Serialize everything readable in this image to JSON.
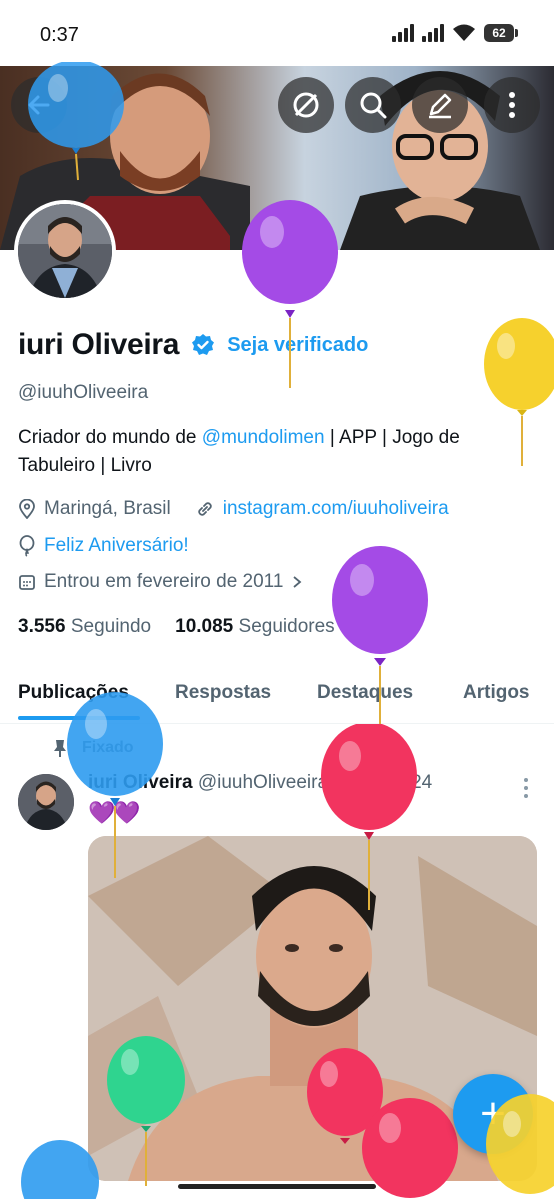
{
  "status_bar": {
    "time": "0:37",
    "battery": "62"
  },
  "profile": {
    "name": "iuri Oliveira",
    "verify_cta": "Seja verificado",
    "handle": "@iuuhOliveeira",
    "bio_prefix": "Criador do mundo de ",
    "bio_mention": "@mundolimen",
    "bio_suffix": "  | APP | Jogo de Tabuleiro | Livro",
    "location": "Maringá, Brasil",
    "website": "instagram.com/iuuholiveira",
    "birthday": "Feliz Aniversário!",
    "joined": "Entrou em fevereiro de 2011",
    "following_count": "3.556",
    "following_label": "Seguindo",
    "followers_count": "10.085",
    "followers_label": "Seguidores"
  },
  "tabs": [
    "Publicações",
    "Respostas",
    "Destaques",
    "Artigos"
  ],
  "pinned_label": "Fixado",
  "post": {
    "author": "iuri Oliveira",
    "handle": "@iuuhOliveeira",
    "date": "· 12 nov. 24",
    "text": "💜💜"
  },
  "fab_label": "+",
  "icons": [
    "back-arrow-icon",
    "no-translate-icon",
    "search-icon",
    "edit-icon",
    "more-vertical-icon",
    "verified-badge-icon",
    "location-icon",
    "link-icon",
    "balloon-icon",
    "calendar-icon",
    "pin-icon"
  ],
  "colors": {
    "accent": "#1d9bf0",
    "text": "#0f1419",
    "secondary": "#536471"
  }
}
